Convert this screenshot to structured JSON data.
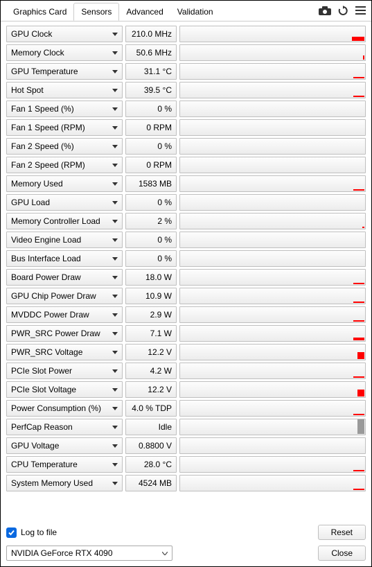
{
  "tabs": [
    "Graphics Card",
    "Sensors",
    "Advanced",
    "Validation"
  ],
  "active_tab": 1,
  "sensors": [
    {
      "label": "GPU Clock",
      "value": "210.0 MHz",
      "spark_w": 18,
      "spark_h": 6
    },
    {
      "label": "Memory Clock",
      "value": "50.6 MHz",
      "spark_w": 2,
      "spark_h": 6
    },
    {
      "label": "GPU Temperature",
      "value": "31.1 °C",
      "spark_w": 16,
      "spark_h": 2
    },
    {
      "label": "Hot Spot",
      "value": "39.5 °C",
      "spark_w": 16,
      "spark_h": 2
    },
    {
      "label": "Fan 1 Speed (%)",
      "value": "0 %",
      "spark_w": 0,
      "spark_h": 0
    },
    {
      "label": "Fan 1 Speed (RPM)",
      "value": "0 RPM",
      "spark_w": 0,
      "spark_h": 0
    },
    {
      "label": "Fan 2 Speed (%)",
      "value": "0 %",
      "spark_w": 0,
      "spark_h": 0
    },
    {
      "label": "Fan 2 Speed (RPM)",
      "value": "0 RPM",
      "spark_w": 0,
      "spark_h": 0
    },
    {
      "label": "Memory Used",
      "value": "1583 MB",
      "spark_w": 16,
      "spark_h": 2
    },
    {
      "label": "GPU Load",
      "value": "0 %",
      "spark_w": 0,
      "spark_h": 0
    },
    {
      "label": "Memory Controller Load",
      "value": "2 %",
      "spark_w": 3,
      "spark_h": 2
    },
    {
      "label": "Video Engine Load",
      "value": "0 %",
      "spark_w": 0,
      "spark_h": 0
    },
    {
      "label": "Bus Interface Load",
      "value": "0 %",
      "spark_w": 0,
      "spark_h": 0
    },
    {
      "label": "Board Power Draw",
      "value": "18.0 W",
      "spark_w": 16,
      "spark_h": 2
    },
    {
      "label": "GPU Chip Power Draw",
      "value": "10.9 W",
      "spark_w": 16,
      "spark_h": 2
    },
    {
      "label": "MVDDC Power Draw",
      "value": "2.9 W",
      "spark_w": 16,
      "spark_h": 2
    },
    {
      "label": "PWR_SRC Power Draw",
      "value": "7.1 W",
      "spark_w": 16,
      "spark_h": 4
    },
    {
      "label": "PWR_SRC Voltage",
      "value": "12.2 V",
      "spark_w": 10,
      "spark_h": 10
    },
    {
      "label": "PCIe Slot Power",
      "value": "4.2 W",
      "spark_w": 16,
      "spark_h": 2
    },
    {
      "label": "PCIe Slot Voltage",
      "value": "12.2 V",
      "spark_w": 10,
      "spark_h": 10
    },
    {
      "label": "Power Consumption (%)",
      "value": "4.0 % TDP",
      "spark_w": 16,
      "spark_h": 2
    },
    {
      "label": "PerfCap Reason",
      "value": "Idle",
      "spark_w": 10,
      "spark_h": 22,
      "spark_color": "#9a9a9a"
    },
    {
      "label": "GPU Voltage",
      "value": "0.8800 V",
      "spark_w": 0,
      "spark_h": 0
    },
    {
      "label": "CPU Temperature",
      "value": "28.0 °C",
      "spark_w": 16,
      "spark_h": 2
    },
    {
      "label": "System Memory Used",
      "value": "4524 MB",
      "spark_w": 16,
      "spark_h": 2
    }
  ],
  "footer": {
    "log_checkbox_label": "Log to file",
    "log_checked": true,
    "gpu_select": "NVIDIA GeForce RTX 4090",
    "reset_label": "Reset",
    "close_label": "Close"
  }
}
